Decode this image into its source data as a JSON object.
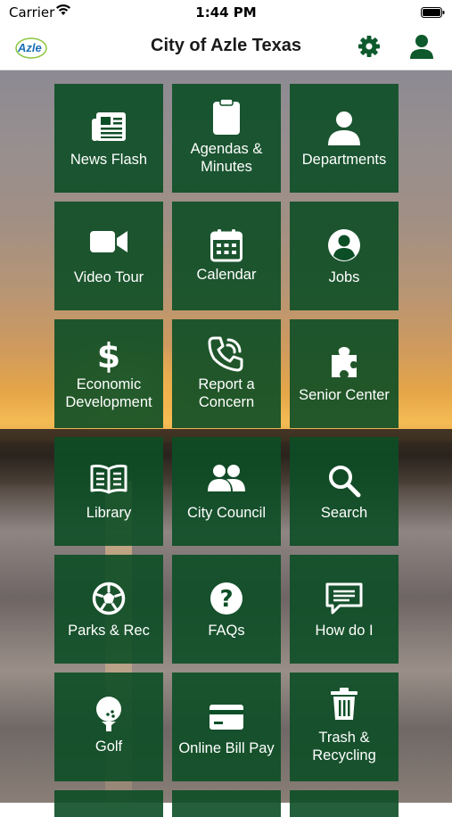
{
  "status_bar": {
    "carrier": "Carrier",
    "time": "1:44 PM"
  },
  "nav": {
    "title": "City of Azle Texas",
    "logo_text": "Azle"
  },
  "colors": {
    "tile_bg": "#0c4e26",
    "accent": "#0f5a2c",
    "header_bg": "#ffffff"
  },
  "tiles": [
    {
      "label_lines": [
        "News Flash"
      ],
      "icon": "newspaper-icon"
    },
    {
      "label_lines": [
        "Agendas &",
        "Minutes"
      ],
      "icon": "clipboard-icon"
    },
    {
      "label_lines": [
        "Departments"
      ],
      "icon": "person-icon"
    },
    {
      "label_lines": [
        "Video Tour"
      ],
      "icon": "video-camera-icon"
    },
    {
      "label_lines": [
        "Calendar"
      ],
      "icon": "calendar-icon"
    },
    {
      "label_lines": [
        "Jobs"
      ],
      "icon": "user-circle-icon"
    },
    {
      "label_lines": [
        "Economic",
        "Development"
      ],
      "icon": "dollar-icon"
    },
    {
      "label_lines": [
        "Report a",
        "Concern"
      ],
      "icon": "phone-ringing-icon"
    },
    {
      "label_lines": [
        "Senior Center"
      ],
      "icon": "puzzle-piece-icon"
    },
    {
      "label_lines": [
        "Library"
      ],
      "icon": "book-open-icon"
    },
    {
      "label_lines": [
        "City Council"
      ],
      "icon": "users-icon"
    },
    {
      "label_lines": [
        "Search"
      ],
      "icon": "search-icon"
    },
    {
      "label_lines": [
        "Parks & Rec"
      ],
      "icon": "soccer-ball-icon"
    },
    {
      "label_lines": [
        "FAQs"
      ],
      "icon": "question-circle-icon"
    },
    {
      "label_lines": [
        "How do I"
      ],
      "icon": "comment-icon"
    },
    {
      "label_lines": [
        "Golf"
      ],
      "icon": "golf-ball-icon"
    },
    {
      "label_lines": [
        "Online Bill Pay"
      ],
      "icon": "credit-card-icon"
    },
    {
      "label_lines": [
        "Trash &",
        "Recycling"
      ],
      "icon": "trash-icon"
    }
  ]
}
